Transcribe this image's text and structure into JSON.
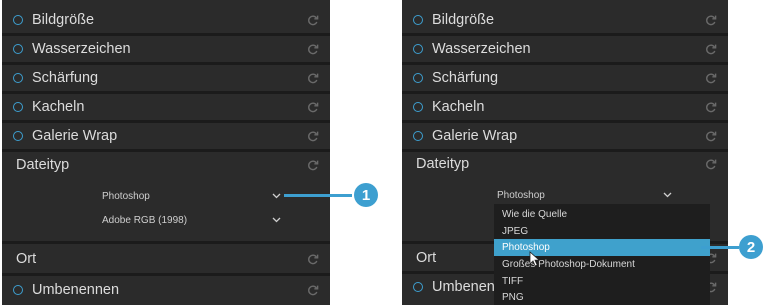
{
  "left_panel": {
    "items": [
      {
        "label": "Bildgröße"
      },
      {
        "label": "Wasserzeichen"
      },
      {
        "label": "Schärfung"
      },
      {
        "label": "Kacheln"
      },
      {
        "label": "Galerie Wrap"
      }
    ],
    "dateityp_label": "Dateityp",
    "file_type_value": "Photoshop",
    "color_profile_value": "Adobe RGB (1998)",
    "ort_label": "Ort",
    "umbenennen_label": "Umbenennen"
  },
  "right_panel": {
    "items": [
      {
        "label": "Bildgröße"
      },
      {
        "label": "Wasserzeichen"
      },
      {
        "label": "Schärfung"
      },
      {
        "label": "Kacheln"
      },
      {
        "label": "Galerie Wrap"
      }
    ],
    "dateityp_label": "Dateityp",
    "file_type_value": "Photoshop",
    "ort_label": "Ort",
    "umbenennen_label": "Umbenennen",
    "dropdown_options": [
      "Wie die Quelle",
      "JPEG",
      "Photoshop",
      "Großes Photoshop-Dokument",
      "TIFF",
      "PNG"
    ],
    "dropdown_selected": "Photoshop"
  },
  "callouts": {
    "one": "1",
    "two": "2"
  },
  "colors": {
    "panel_bg": "#2b2b2b",
    "accent": "#3d9fd0",
    "highlight": "#3fa1cc",
    "text": "#dcdcdc"
  },
  "icons": {
    "radio": "radio-circle-icon",
    "reset": "reset-arrow-icon",
    "chevron": "chevron-down-icon",
    "cursor": "mouse-pointer-icon"
  }
}
